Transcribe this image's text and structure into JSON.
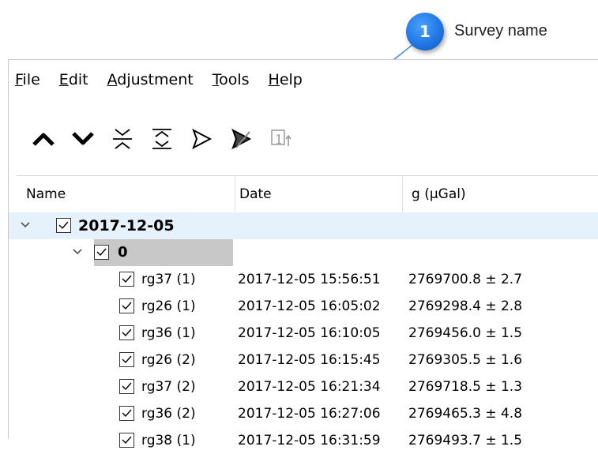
{
  "callout": {
    "number": "1",
    "label": "Survey name"
  },
  "menu": [
    {
      "pre": "",
      "u": "F",
      "post": "ile"
    },
    {
      "pre": "",
      "u": "E",
      "post": "dit"
    },
    {
      "pre": "",
      "u": "A",
      "post": "djustment"
    },
    {
      "pre": "",
      "u": "T",
      "post": "ools"
    },
    {
      "pre": "",
      "u": "H",
      "post": "elp"
    }
  ],
  "toolbar": {
    "icons": [
      "chevron-up-icon",
      "chevron-down-icon",
      "collapse-all-icon",
      "expand-all-icon",
      "triangle-outline-icon",
      "triangle-filled-icon",
      "step-one-icon"
    ]
  },
  "table": {
    "columns": [
      "Name",
      "Date",
      "g (µGal)"
    ],
    "survey": {
      "name": "2017-12-05"
    },
    "loop": {
      "name": "0"
    },
    "rows": [
      {
        "name": "rg37 (1)",
        "date": "2017-12-05 15:56:51",
        "g": "2769700.8 ± 2.7"
      },
      {
        "name": "rg26 (1)",
        "date": "2017-12-05 16:05:02",
        "g": "2769298.4 ± 2.8"
      },
      {
        "name": "rg36 (1)",
        "date": "2017-12-05 16:10:05",
        "g": "2769456.0 ± 1.5"
      },
      {
        "name": "rg26 (2)",
        "date": "2017-12-05 16:15:45",
        "g": "2769305.5 ± 1.6"
      },
      {
        "name": "rg37 (2)",
        "date": "2017-12-05 16:21:34",
        "g": "2769718.5 ± 1.3"
      },
      {
        "name": "rg36 (2)",
        "date": "2017-12-05 16:27:06",
        "g": "2769465.3 ± 4.8"
      },
      {
        "name": "rg38 (1)",
        "date": "2017-12-05 16:31:59",
        "g": "2769493.7 ± 1.5"
      }
    ]
  }
}
